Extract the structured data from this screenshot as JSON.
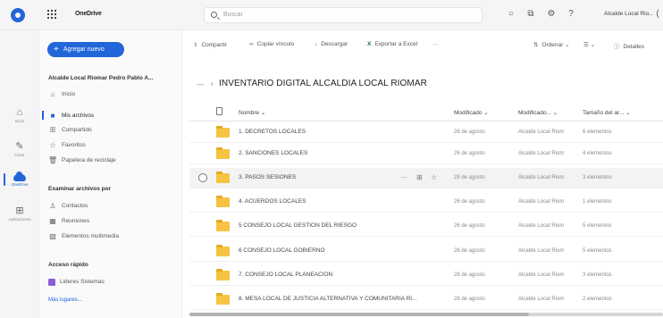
{
  "topbar": {
    "app_name": "OneDrive",
    "search_placeholder": "Buscar",
    "user_name": "Alcalde Local Rio..."
  },
  "rail": {
    "items": [
      {
        "label": "Inicio",
        "icon": "home-icon"
      },
      {
        "label": "Crear",
        "icon": "pen-icon"
      },
      {
        "label": "OneDrive",
        "icon": "cloud-icon"
      },
      {
        "label": "Aplicaciones",
        "icon": "apps-icon"
      }
    ]
  },
  "nav": {
    "new_button": "Agregar nuevo",
    "owner": "Alcalde Local Riomar Pedro Pablo A...",
    "items": [
      {
        "label": "Inicio",
        "icon": "home-icon"
      },
      {
        "label": "Mis archivos",
        "icon": "folder-icon"
      },
      {
        "label": "Compartido",
        "icon": "people-icon"
      },
      {
        "label": "Favoritos",
        "icon": "star-icon"
      },
      {
        "label": "Papelera de reciclaje",
        "icon": "trash-icon"
      }
    ],
    "browse_title": "Examinar archivos por",
    "browse_items": [
      {
        "label": "Contactos",
        "icon": "person-icon"
      },
      {
        "label": "Reuniones",
        "icon": "calendar-icon"
      },
      {
        "label": "Elementos multimedia",
        "icon": "image-icon"
      }
    ],
    "quick_title": "Acceso rápido",
    "quick_items": [
      {
        "label": "Lideres Sistemas"
      }
    ],
    "more_link": "Más lugares..."
  },
  "cmdbar": {
    "share": "Compartir",
    "copy_link": "Copiar vínculo",
    "download": "Descargar",
    "export_excel": "Exportar a Excel",
    "more": "···",
    "sort": "Ordenar",
    "details": "Detalles"
  },
  "breadcrumb": {
    "title": "INVENTARIO DIGITAL ALCALDIA LOCAL RIOMAR"
  },
  "table": {
    "headers": {
      "name": "Nombre",
      "modified": "Modificado",
      "modified_by": "Modificado...",
      "size": "Tamaño del ar..."
    },
    "rows": [
      {
        "name": "1. DECRETOS LOCALES",
        "modified": "26 de agosto",
        "modified_by": "Alcalde Local Riom",
        "size": "6 elementos"
      },
      {
        "name": "2. SANCIONES LOCALES",
        "modified": "26 de agosto",
        "modified_by": "Alcalde Local Riom",
        "size": "4 elementos"
      },
      {
        "name": "3. PASOS SESIONES",
        "modified": "28 de agosto",
        "modified_by": "Alcalde Local Riom",
        "size": "3 elementos"
      },
      {
        "name": "4. ACUERDOS LOCALES",
        "modified": "26 de agosto",
        "modified_by": "Alcalde Local Riom",
        "size": "1 elementos"
      },
      {
        "name": "5 CONSEJO LOCAL GESTION DEL RIESGO",
        "modified": "26 de agosto",
        "modified_by": "Alcalde Local Riom",
        "size": "5 elementos"
      },
      {
        "name": "6 CONSEJO LOCAL GOBIERNO",
        "modified": "26 de agosto",
        "modified_by": "Alcalde Local Riom",
        "size": "5 elementos"
      },
      {
        "name": "7. CONSEJO LOCAL PLANEACION",
        "modified": "28 de agosto",
        "modified_by": "Alcalde Local Riom",
        "size": "3 elementos"
      },
      {
        "name": "8. MESA LOCAL DE JUSTICIA ALTERNATIVA Y COMUNITARIA RI...",
        "modified": "28 de agosto",
        "modified_by": "Alcalde Local Riom",
        "size": "2 elementos"
      }
    ]
  },
  "colors": {
    "accent": "#2266d8",
    "folder": "#f6c342"
  }
}
